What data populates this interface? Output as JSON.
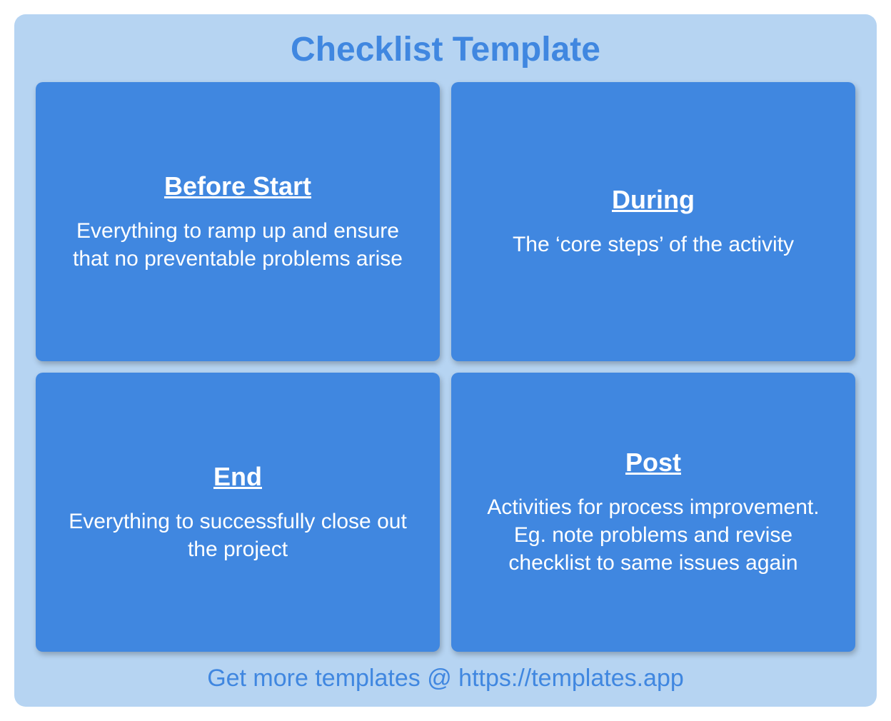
{
  "title": "Checklist Template",
  "cards": [
    {
      "title": "Before Start",
      "desc": "Everything to ramp up and ensure that no preventable problems arise"
    },
    {
      "title": "During",
      "desc": "The ‘core steps’ of the activity"
    },
    {
      "title": "End",
      "desc": "Everything to successfully close out the project"
    },
    {
      "title": "Post",
      "desc": "Activities for process improvement. Eg. note problems and revise checklist to same issues again"
    }
  ],
  "footer": "Get more templates @ https://templates.app"
}
